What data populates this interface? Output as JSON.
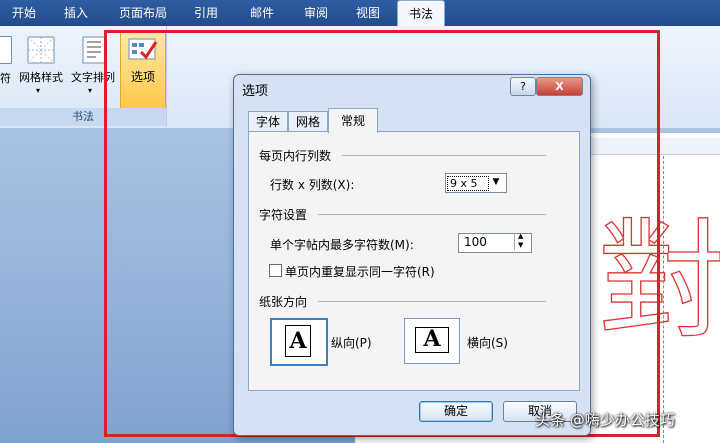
{
  "ribbon": {
    "tabs": [
      "开始",
      "插入",
      "页面布局",
      "引用",
      "邮件",
      "审阅",
      "视图",
      "书法"
    ],
    "active_tab": "书法",
    "group": {
      "label": "书法",
      "buttons": [
        {
          "label": "符",
          "icon": "font-icon"
        },
        {
          "label": "网格样式",
          "icon": "grid-style-icon"
        },
        {
          "label": "文字排列",
          "icon": "text-arrange-icon"
        },
        {
          "label": "选项",
          "icon": "options-icon"
        }
      ]
    }
  },
  "dialog": {
    "title": "选项",
    "help_label": "?",
    "close_label": "X",
    "tabs": [
      "字体",
      "网格",
      "常规"
    ],
    "active_tab": "常规",
    "section_rows_cols": {
      "title": "每页内行列数",
      "label": "行数 x 列数(X):",
      "value": "9 x 5"
    },
    "section_chars": {
      "title": "字符设置",
      "max_chars_label": "单个字帖内最多字符数(M):",
      "max_chars_value": "100",
      "repeat_label": "单页内重复显示同一字符(R)",
      "repeat_checked": false
    },
    "section_orientation": {
      "title": "纸张方向",
      "portrait_label": "纵向(P)",
      "landscape_label": "横向(S)",
      "glyph": "A",
      "selected": "portrait"
    },
    "ok_label": "确定",
    "cancel_label": "取消"
  },
  "document": {
    "calligraphy_char": "對"
  },
  "watermark": "头条 @嗨少办公技巧",
  "colors": {
    "highlight": "#d7222b",
    "tab_bar": "#2f5ea3",
    "dialog_bg": "#d6e2f3"
  }
}
